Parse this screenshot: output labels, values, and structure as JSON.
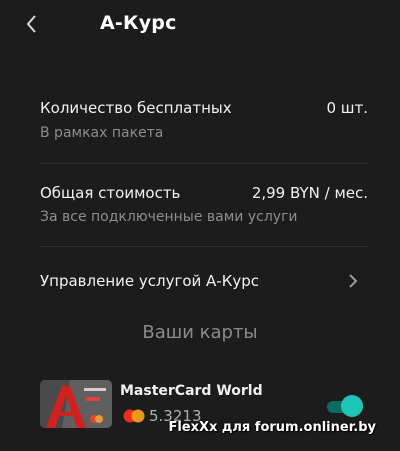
{
  "header": {
    "title": "А-Курс"
  },
  "rows": [
    {
      "label": "Количество бесплатных",
      "sublabel": "В рамках пакета",
      "value": "0 шт."
    },
    {
      "label": "Общая стоимость",
      "sublabel": "За все подключенные вами услуги",
      "value": "2,99 BYN / мес."
    }
  ],
  "manage": {
    "label": "Управление услугой А-Курс"
  },
  "cards_section": {
    "title": "Ваши карты",
    "cards": [
      {
        "name": "MasterCard World",
        "masked_number": "5.3213",
        "enabled": true
      }
    ]
  },
  "icons": {
    "back": "chevron-left-icon",
    "manage": "chevron-right-icon",
    "card_brand": "mastercard-icon"
  },
  "colors": {
    "background": "#1c1c1c",
    "accent": "#1fc6b7",
    "card_red": "#d1201e"
  },
  "watermark": "FlexXx для forum.onliner.by"
}
